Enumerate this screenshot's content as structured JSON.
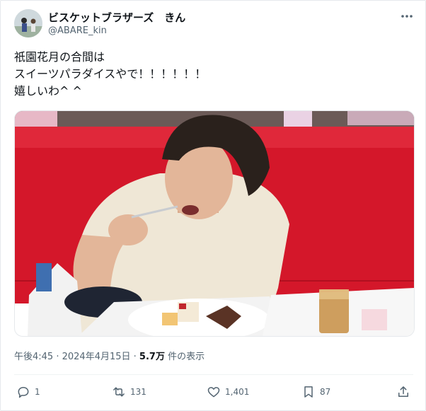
{
  "author": {
    "name": "ビスケットブラザーズ　きん",
    "handle": "@ABARE_kin"
  },
  "tweet": {
    "text": "祇園花月の合間は\nスイーツパラダイスやで！！！！！！\n嬉しいわ^ ^"
  },
  "meta": {
    "time": "午後4:45",
    "separator": " · ",
    "date": "2024年4月15日",
    "views_count": "5.7万",
    "views_label": " 件の表示"
  },
  "actions": {
    "replies": "1",
    "reposts": "131",
    "likes": "1,401",
    "bookmarks": "87"
  },
  "icons": {
    "more": "more-dots-icon",
    "reply": "reply-icon",
    "repost": "repost-icon",
    "like": "like-icon",
    "bookmark": "bookmark-icon",
    "share": "share-icon"
  },
  "colors": {
    "text": "#0f1419",
    "secondary": "#536471",
    "booth_red": "#d4172a"
  }
}
